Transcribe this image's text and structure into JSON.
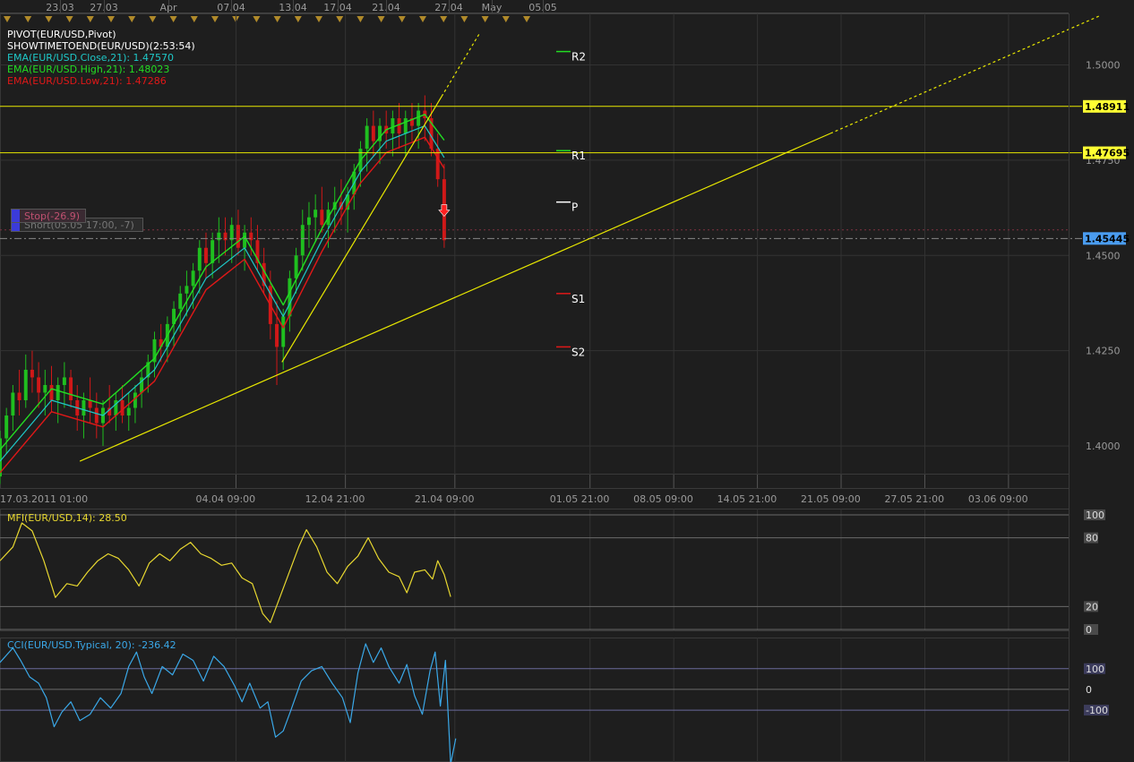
{
  "colors": {
    "background": "#1e1e1e",
    "grid": "#333333",
    "axis_text": "#9a9a9a",
    "bull_candle": "#1fbf1f",
    "bear_candle": "#d01818",
    "ema_close": "#1ec8c8",
    "ema_high": "#22dd22",
    "ema_low": "#e01818",
    "trendline": "#e8e800",
    "mfi": "#e8d830",
    "cci": "#3aa8e8",
    "price_tag": "#ffff33",
    "current_tag": "#4a9cf0",
    "event_marker": "#b08a2a"
  },
  "legend": {
    "pivot": "PIVOT(EUR/USD,Pivot)",
    "timer": "SHOWTIMETOEND(EUR/USD)(2:53:54)",
    "ema_close": "EMA(EUR/USD.Close,21): 1.47570",
    "ema_high": "EMA(EUR/USD.High,21): 1.48023",
    "ema_low": "EMA(EUR/USD.Low,21): 1.47286"
  },
  "top_dates": [
    "23.03",
    "27.03",
    "Apr",
    "07.04",
    "13.04",
    "17.04",
    "21.04",
    "27.04",
    "May",
    "05.05"
  ],
  "orders": {
    "stop": "Stop(-26.9)",
    "short": "Short(05.05 17:00, -7)"
  },
  "chart_data": [
    {
      "type": "candlestick",
      "symbol": "EUR/USD",
      "x_tick_labels": [
        "17.03.2011 01:00",
        "04.04 09:00",
        "12.04 21:00",
        "21.04 09:00",
        "01.05 21:00",
        "08.05 09:00",
        "14.05 21:00",
        "21.05 09:00",
        "27.05 21:00",
        "03.06 09:00"
      ],
      "y_tick_labels": [
        "1.5000",
        "1.4750",
        "1.4500",
        "1.4250",
        "1.4000"
      ],
      "y_ticks": [
        1.5,
        1.475,
        1.45,
        1.425,
        1.4
      ],
      "ylim": [
        1.3925,
        1.5135
      ],
      "x_range_days": [
        0,
        83
      ],
      "x_tick_days": [
        0,
        18.33,
        26.83,
        35.33,
        45.83,
        52.33,
        58.83,
        65.33,
        71.83,
        78.33
      ],
      "candles_approx": [
        [
          0,
          1.392,
          1.404,
          1.39,
          1.402
        ],
        [
          0.5,
          1.402,
          1.41,
          1.398,
          1.408
        ],
        [
          1,
          1.408,
          1.416,
          1.404,
          1.414
        ],
        [
          1.5,
          1.414,
          1.42,
          1.408,
          1.412
        ],
        [
          2,
          1.412,
          1.424,
          1.41,
          1.42
        ],
        [
          2.5,
          1.42,
          1.425,
          1.414,
          1.418
        ],
        [
          3,
          1.418,
          1.422,
          1.41,
          1.414
        ],
        [
          3.5,
          1.414,
          1.42,
          1.408,
          1.416
        ],
        [
          4,
          1.416,
          1.421,
          1.409,
          1.412
        ],
        [
          4.5,
          1.412,
          1.418,
          1.406,
          1.416
        ],
        [
          5,
          1.416,
          1.422,
          1.41,
          1.418
        ],
        [
          5.5,
          1.418,
          1.42,
          1.41,
          1.412
        ],
        [
          6,
          1.412,
          1.416,
          1.404,
          1.408
        ],
        [
          6.5,
          1.408,
          1.414,
          1.402,
          1.412
        ],
        [
          7,
          1.412,
          1.418,
          1.406,
          1.41
        ],
        [
          7.5,
          1.41,
          1.414,
          1.402,
          1.406
        ],
        [
          8,
          1.406,
          1.412,
          1.4,
          1.41
        ],
        [
          8.5,
          1.41,
          1.416,
          1.406,
          1.408
        ],
        [
          9,
          1.408,
          1.414,
          1.404,
          1.412
        ],
        [
          9.5,
          1.412,
          1.416,
          1.406,
          1.408
        ],
        [
          10,
          1.408,
          1.414,
          1.404,
          1.41
        ],
        [
          10.5,
          1.41,
          1.416,
          1.406,
          1.414
        ],
        [
          11,
          1.414,
          1.42,
          1.41,
          1.418
        ],
        [
          11.5,
          1.418,
          1.424,
          1.414,
          1.422
        ],
        [
          12,
          1.422,
          1.43,
          1.418,
          1.428
        ],
        [
          12.5,
          1.428,
          1.432,
          1.422,
          1.426
        ],
        [
          13,
          1.426,
          1.434,
          1.422,
          1.432
        ],
        [
          13.5,
          1.432,
          1.438,
          1.426,
          1.436
        ],
        [
          14,
          1.436,
          1.442,
          1.43,
          1.44
        ],
        [
          14.5,
          1.44,
          1.446,
          1.434,
          1.442
        ],
        [
          15,
          1.442,
          1.448,
          1.436,
          1.446
        ],
        [
          15.5,
          1.446,
          1.454,
          1.44,
          1.452
        ],
        [
          16,
          1.452,
          1.456,
          1.444,
          1.448
        ],
        [
          16.5,
          1.448,
          1.456,
          1.444,
          1.454
        ],
        [
          17,
          1.454,
          1.46,
          1.448,
          1.456
        ],
        [
          17.5,
          1.456,
          1.46,
          1.45,
          1.454
        ],
        [
          18,
          1.454,
          1.46,
          1.448,
          1.458
        ],
        [
          18.5,
          1.458,
          1.462,
          1.45,
          1.452
        ],
        [
          19,
          1.452,
          1.458,
          1.446,
          1.456
        ],
        [
          19.5,
          1.456,
          1.46,
          1.45,
          1.454
        ],
        [
          20,
          1.454,
          1.458,
          1.446,
          1.448
        ],
        [
          20.5,
          1.448,
          1.452,
          1.44,
          1.442
        ],
        [
          21,
          1.442,
          1.446,
          1.428,
          1.432
        ],
        [
          21.5,
          1.432,
          1.438,
          1.416,
          1.426
        ],
        [
          22,
          1.426,
          1.436,
          1.42,
          1.434
        ],
        [
          22.5,
          1.434,
          1.446,
          1.43,
          1.444
        ],
        [
          23,
          1.444,
          1.452,
          1.44,
          1.45
        ],
        [
          23.5,
          1.45,
          1.462,
          1.446,
          1.458
        ],
        [
          24,
          1.458,
          1.464,
          1.452,
          1.46
        ],
        [
          24.5,
          1.46,
          1.466,
          1.454,
          1.462
        ],
        [
          25,
          1.462,
          1.468,
          1.456,
          1.458
        ],
        [
          25.5,
          1.458,
          1.464,
          1.452,
          1.462
        ],
        [
          26,
          1.462,
          1.468,
          1.456,
          1.464
        ],
        [
          26.5,
          1.464,
          1.47,
          1.458,
          1.462
        ],
        [
          27,
          1.462,
          1.468,
          1.456,
          1.466
        ],
        [
          27.5,
          1.466,
          1.474,
          1.462,
          1.472
        ],
        [
          28,
          1.472,
          1.48,
          1.468,
          1.478
        ],
        [
          28.5,
          1.478,
          1.486,
          1.472,
          1.484
        ],
        [
          29,
          1.484,
          1.488,
          1.476,
          1.48
        ],
        [
          29.5,
          1.48,
          1.486,
          1.474,
          1.484
        ],
        [
          30,
          1.484,
          1.488,
          1.478,
          1.482
        ],
        [
          30.5,
          1.482,
          1.488,
          1.476,
          1.486
        ],
        [
          31,
          1.486,
          1.49,
          1.478,
          1.482
        ],
        [
          31.5,
          1.482,
          1.488,
          1.476,
          1.486
        ],
        [
          32,
          1.486,
          1.49,
          1.48,
          1.484
        ],
        [
          32.5,
          1.484,
          1.49,
          1.478,
          1.488
        ],
        [
          33,
          1.488,
          1.492,
          1.48,
          1.486
        ],
        [
          33.5,
          1.486,
          1.49,
          1.476,
          1.478
        ],
        [
          34,
          1.478,
          1.482,
          1.468,
          1.47
        ],
        [
          34.5,
          1.47,
          1.474,
          1.452,
          1.454
        ]
      ],
      "ema_close_approx": [
        [
          0,
          1.396
        ],
        [
          4,
          1.412
        ],
        [
          8,
          1.408
        ],
        [
          12,
          1.42
        ],
        [
          16,
          1.444
        ],
        [
          19,
          1.452
        ],
        [
          21,
          1.44
        ],
        [
          22,
          1.434
        ],
        [
          25,
          1.454
        ],
        [
          28,
          1.472
        ],
        [
          30,
          1.48
        ],
        [
          33,
          1.484
        ],
        [
          34.5,
          1.4757
        ]
      ],
      "ema_high_approx": [
        [
          0,
          1.399
        ],
        [
          4,
          1.415
        ],
        [
          8,
          1.411
        ],
        [
          12,
          1.423
        ],
        [
          16,
          1.447
        ],
        [
          19,
          1.455
        ],
        [
          21,
          1.443
        ],
        [
          22,
          1.437
        ],
        [
          25,
          1.457
        ],
        [
          28,
          1.475
        ],
        [
          30,
          1.483
        ],
        [
          33,
          1.487
        ],
        [
          34.5,
          1.48023
        ]
      ],
      "ema_low_approx": [
        [
          0,
          1.393
        ],
        [
          4,
          1.409
        ],
        [
          8,
          1.405
        ],
        [
          12,
          1.417
        ],
        [
          16,
          1.441
        ],
        [
          19,
          1.449
        ],
        [
          21,
          1.437
        ],
        [
          22,
          1.431
        ],
        [
          25,
          1.451
        ],
        [
          28,
          1.469
        ],
        [
          30,
          1.477
        ],
        [
          33,
          1.481
        ],
        [
          34.5,
          1.47286
        ]
      ],
      "horizontal_levels": [
        {
          "price": 1.48911,
          "label": "1.48911"
        },
        {
          "price": 1.47695,
          "label": "1.47695"
        },
        {
          "price": 1.45445,
          "label": "1.45445"
        }
      ],
      "pivots": [
        {
          "label": "R2",
          "price": 1.5035
        },
        {
          "label": "R1",
          "price": 1.4775
        },
        {
          "label": "P",
          "price": 1.464
        },
        {
          "label": "S1",
          "price": 1.44
        },
        {
          "label": "S2",
          "price": 1.426
        }
      ],
      "trendlines": [
        {
          "from": [
            6.2,
            1.396
          ],
          "to": [
            85.5,
            1.513
          ],
          "dashed_from_day": 64.5
        },
        {
          "from": [
            21.9,
            1.422
          ],
          "to": [
            37.2,
            1.508
          ],
          "dashed_from_day": 34.3
        }
      ]
    },
    {
      "type": "line",
      "title": "MFI(EUR/USD,14): 28.50",
      "ylim": [
        0,
        100
      ],
      "y_tick_labels": [
        "100",
        "80",
        "20",
        "0"
      ],
      "y_ticks": [
        100,
        80,
        20,
        0
      ],
      "values_approx": [
        [
          0,
          60
        ],
        [
          1,
          72
        ],
        [
          1.7,
          93
        ],
        [
          2.5,
          86
        ],
        [
          3.4,
          60
        ],
        [
          4.3,
          28
        ],
        [
          5.2,
          40
        ],
        [
          6,
          38
        ],
        [
          6.8,
          50
        ],
        [
          7.6,
          60
        ],
        [
          8.4,
          66
        ],
        [
          9.2,
          62
        ],
        [
          10,
          52
        ],
        [
          10.8,
          38
        ],
        [
          11.6,
          58
        ],
        [
          12.4,
          66
        ],
        [
          13.2,
          60
        ],
        [
          14,
          70
        ],
        [
          14.8,
          76
        ],
        [
          15.6,
          66
        ],
        [
          16.4,
          62
        ],
        [
          17.2,
          56
        ],
        [
          18,
          58
        ],
        [
          18.8,
          45
        ],
        [
          19.6,
          40
        ],
        [
          20.4,
          14
        ],
        [
          21,
          6
        ],
        [
          21.6,
          24
        ],
        [
          22.4,
          48
        ],
        [
          23.2,
          72
        ],
        [
          23.8,
          87
        ],
        [
          24.6,
          72
        ],
        [
          25.4,
          50
        ],
        [
          26.2,
          40
        ],
        [
          27,
          55
        ],
        [
          27.8,
          64
        ],
        [
          28.6,
          80
        ],
        [
          29.4,
          62
        ],
        [
          30.2,
          50
        ],
        [
          31,
          46
        ],
        [
          31.6,
          32
        ],
        [
          32.2,
          50
        ],
        [
          33,
          52
        ],
        [
          33.6,
          44
        ],
        [
          34,
          60
        ],
        [
          34.5,
          48
        ],
        [
          35,
          28.5
        ]
      ]
    },
    {
      "type": "line",
      "title": "CCI(EUR/USD.Typical, 20): -236.42",
      "ylim": [
        -350,
        250
      ],
      "y_tick_labels": [
        "100",
        "0",
        "-100"
      ],
      "y_ticks": [
        100,
        0,
        -100
      ],
      "values_approx": [
        [
          0,
          130
        ],
        [
          1,
          200
        ],
        [
          1.6,
          140
        ],
        [
          2.3,
          60
        ],
        [
          3,
          30
        ],
        [
          3.6,
          -40
        ],
        [
          4.2,
          -180
        ],
        [
          4.8,
          -110
        ],
        [
          5.5,
          -60
        ],
        [
          6.2,
          -150
        ],
        [
          7,
          -120
        ],
        [
          7.8,
          -40
        ],
        [
          8.6,
          -90
        ],
        [
          9.4,
          -20
        ],
        [
          10,
          110
        ],
        [
          10.6,
          180
        ],
        [
          11.2,
          60
        ],
        [
          11.8,
          -20
        ],
        [
          12.6,
          110
        ],
        [
          13.4,
          70
        ],
        [
          14.2,
          170
        ],
        [
          15,
          140
        ],
        [
          15.8,
          40
        ],
        [
          16.6,
          160
        ],
        [
          17.4,
          110
        ],
        [
          18.2,
          20
        ],
        [
          18.8,
          -60
        ],
        [
          19.4,
          30
        ],
        [
          20.2,
          -90
        ],
        [
          20.8,
          -60
        ],
        [
          21.4,
          -230
        ],
        [
          22,
          -200
        ],
        [
          22.6,
          -100
        ],
        [
          23.4,
          40
        ],
        [
          24.2,
          90
        ],
        [
          25,
          110
        ],
        [
          25.8,
          30
        ],
        [
          26.6,
          -40
        ],
        [
          27.2,
          -160
        ],
        [
          27.8,
          80
        ],
        [
          28.4,
          220
        ],
        [
          29,
          130
        ],
        [
          29.6,
          200
        ],
        [
          30.2,
          110
        ],
        [
          31,
          30
        ],
        [
          31.6,
          120
        ],
        [
          32.2,
          -30
        ],
        [
          32.8,
          -120
        ],
        [
          33.4,
          90
        ],
        [
          33.8,
          180
        ],
        [
          34.2,
          -80
        ],
        [
          34.6,
          140
        ],
        [
          35,
          -360
        ],
        [
          35.4,
          -236.42
        ]
      ]
    }
  ]
}
